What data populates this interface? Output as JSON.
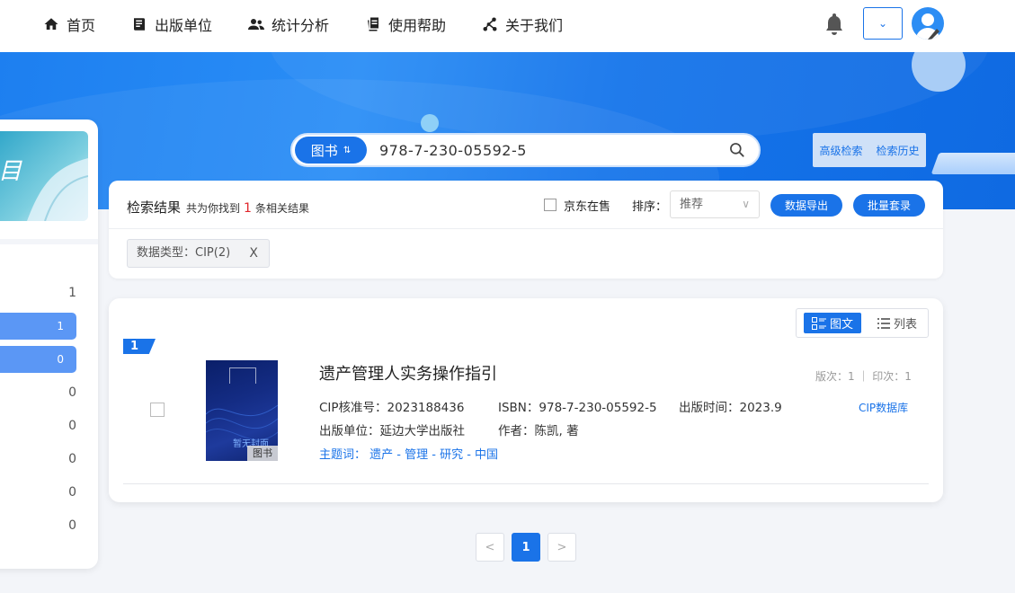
{
  "nav": {
    "items": [
      {
        "label": "首页",
        "icon": "home-icon"
      },
      {
        "label": "出版单位",
        "icon": "book-icon"
      },
      {
        "label": "统计分析",
        "icon": "users-icon"
      },
      {
        "label": "使用帮助",
        "icon": "document-icon"
      },
      {
        "label": "关于我们",
        "icon": "network-icon"
      }
    ],
    "bell_icon": "bell-icon",
    "dropdown_caret": "⌄",
    "avatar_icon": "user-avatar-icon"
  },
  "search": {
    "type_label": "图书",
    "type_sort_glyph": "⇅",
    "value": "978-7-230-05592-5",
    "advanced_label": "高级检索",
    "history_label": "检索历史"
  },
  "left_panel": {
    "counts": [
      "1",
      "1",
      "0",
      "0",
      "0",
      "0",
      "0",
      "0"
    ]
  },
  "results": {
    "heading": "检索结果",
    "summary_prefix": "共为你找到",
    "count": "1",
    "summary_suffix": "条相关结果",
    "jd_label": "京东在售",
    "sort_label": "排序：",
    "sort_value": "推荐",
    "export_label": "数据导出",
    "batch_label": "批量套录",
    "filter_tag": "数据类型：CIP(2)",
    "filter_close": "X"
  },
  "view": {
    "grid_label": "图文",
    "list_label": "列表"
  },
  "item": {
    "index": "1",
    "cover_text": "暂无封面",
    "cover_tag": "图书",
    "title": "遗产管理人实务操作指引",
    "edition": "版次：1 ｜ 印次：1",
    "cip_no": "CIP核准号：2023188436",
    "isbn": "ISBN：978-7-230-05592-5",
    "pub_time": "出版时间：2023.9",
    "publisher": "出版单位：延边大学出版社",
    "author": "作者：陈凯, 著",
    "subject_label": "主题词：",
    "subjects": "遗产 - 管理 - 研究 - 中国",
    "cip_db": "CIP数据库"
  },
  "pagination": {
    "prev": "<",
    "current": "1",
    "next": ">"
  },
  "colors": {
    "accent": "#1a73e8",
    "highlight_red": "#e0262b"
  }
}
